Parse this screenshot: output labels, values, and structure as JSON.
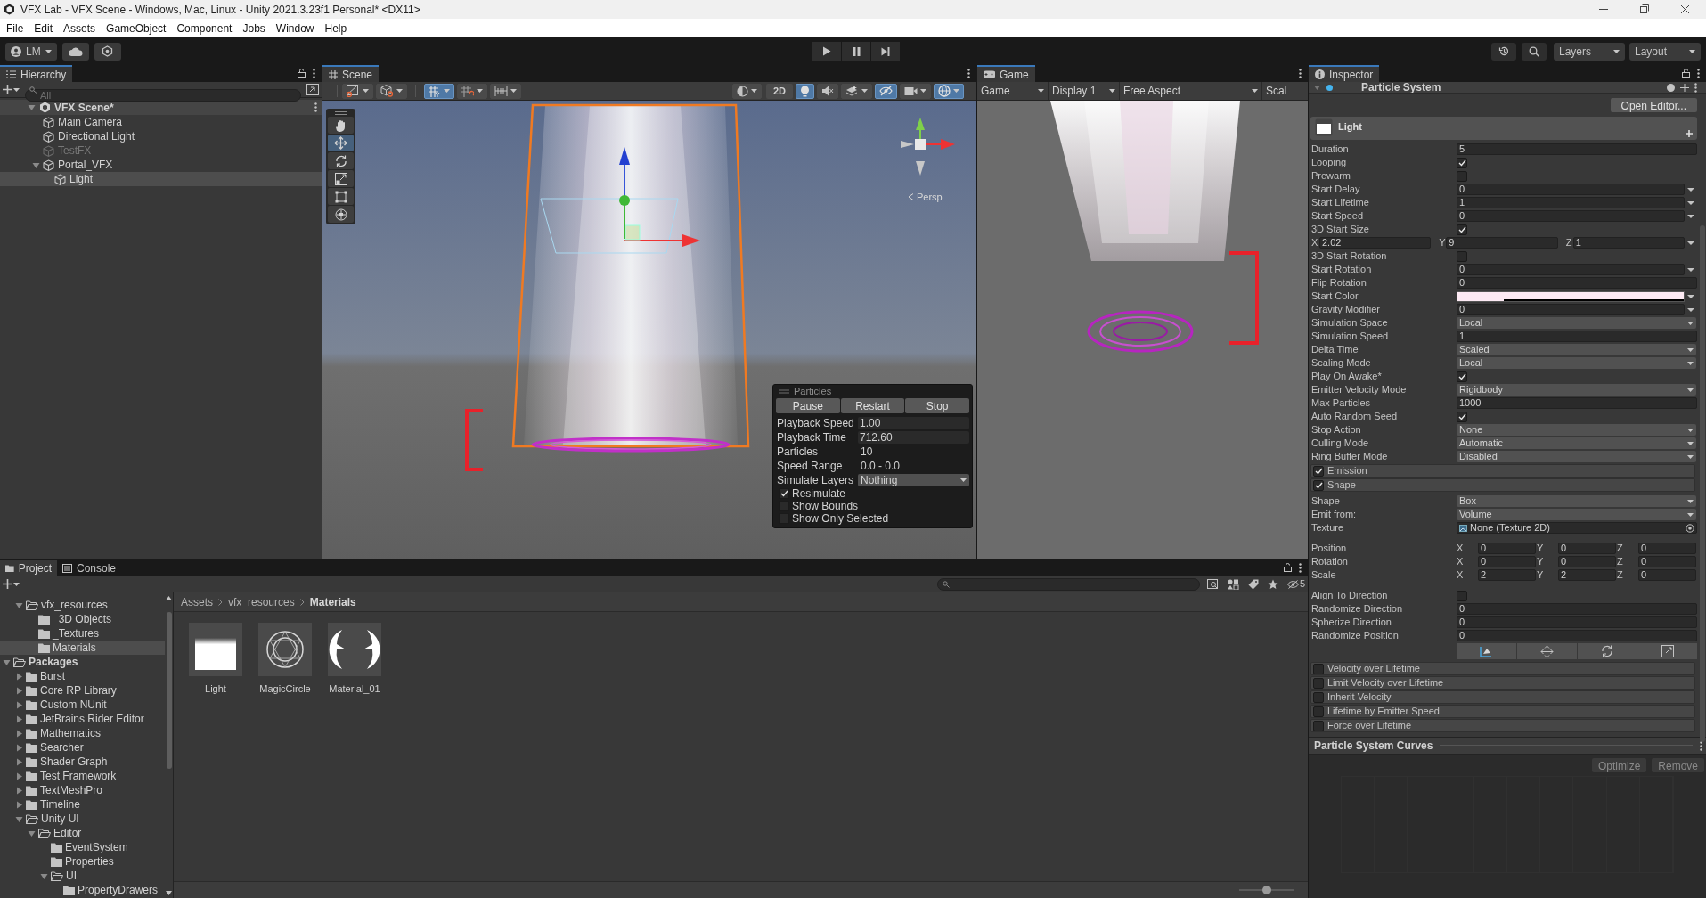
{
  "window": {
    "title": "VFX Lab - VFX Scene - Windows, Mac, Linux - Unity 2021.3.23f1 Personal* <DX11>"
  },
  "menu": [
    "File",
    "Edit",
    "Assets",
    "GameObject",
    "Component",
    "Jobs",
    "Window",
    "Help"
  ],
  "toolbar": {
    "account": "LM",
    "layers": "Layers",
    "layout": "Layout"
  },
  "hierarchy": {
    "title": "Hierarchy",
    "search_placeholder": "All",
    "scene": {
      "name": "VFX Scene*",
      "expanded": true
    },
    "objects": [
      {
        "name": "Main Camera",
        "active": true,
        "selected": false
      },
      {
        "name": "Directional Light",
        "active": true,
        "selected": false
      },
      {
        "name": "TestFX",
        "active": false,
        "selected": false
      },
      {
        "name": "Portal_VFX",
        "active": true,
        "selected": false,
        "expanded": true,
        "children": [
          {
            "name": "Light",
            "active": true,
            "selected": true
          }
        ]
      }
    ]
  },
  "scene_view": {
    "tab": "Scene",
    "toggle_2d": "2D",
    "persp": "Persp",
    "grid_on": true,
    "lighting_on": true,
    "hidden_on": true,
    "gizmos_on": true,
    "tools": [
      {
        "kind": "hand",
        "selected": false
      },
      {
        "kind": "move",
        "selected": true
      },
      {
        "kind": "rotate",
        "selected": false
      },
      {
        "kind": "scale",
        "selected": false
      },
      {
        "kind": "rect",
        "selected": false
      },
      {
        "kind": "transform",
        "selected": false
      }
    ]
  },
  "particles_overlay": {
    "title": "Particles",
    "buttons": [
      "Pause",
      "Restart",
      "Stop"
    ],
    "fields": [
      {
        "label": "Playback Speed",
        "value": "1.00",
        "kind": "input"
      },
      {
        "label": "Playback Time",
        "value": "712.60",
        "kind": "input"
      },
      {
        "label": "Particles",
        "value": "10",
        "kind": "text"
      },
      {
        "label": "Speed Range",
        "value": "0.0 - 0.0",
        "kind": "text"
      },
      {
        "label": "Simulate Layers",
        "value": "Nothing",
        "kind": "dropdown"
      }
    ],
    "options": [
      {
        "label": "Resimulate",
        "checked": true
      },
      {
        "label": "Show Bounds",
        "checked": false
      },
      {
        "label": "Show Only Selected",
        "checked": false
      }
    ]
  },
  "game_view": {
    "tab": "Game",
    "dropdowns": [
      "Game",
      "Display 1",
      "Free Aspect"
    ],
    "scale_label": "Scal"
  },
  "inspector": {
    "tab": "Inspector",
    "component": "Particle System",
    "open_editor": "Open Editor...",
    "system_name": "Light",
    "main": [
      {
        "label": "Duration",
        "kind": "input",
        "value": "5"
      },
      {
        "label": "Looping",
        "kind": "checkbox",
        "checked": true
      },
      {
        "label": "Prewarm",
        "kind": "checkbox",
        "checked": false
      },
      {
        "label": "Start Delay",
        "kind": "curve",
        "value": "0"
      },
      {
        "label": "Start Lifetime",
        "kind": "curve",
        "value": "1"
      },
      {
        "label": "Start Speed",
        "kind": "curve",
        "value": "0"
      },
      {
        "label": "3D Start Size",
        "kind": "checkbox",
        "checked": true
      },
      {
        "kind": "xyz",
        "axes": [
          {
            "axis": "X",
            "value": "2.02"
          },
          {
            "axis": "Y",
            "value": "9"
          },
          {
            "axis": "Z",
            "value": "1"
          }
        ]
      },
      {
        "label": "3D Start Rotation",
        "kind": "checkbox",
        "checked": false
      },
      {
        "label": "Start Rotation",
        "kind": "curve",
        "value": "0"
      },
      {
        "label": "Flip Rotation",
        "kind": "input",
        "value": "0"
      },
      {
        "label": "Start Color",
        "kind": "color",
        "color": "#fdeaf4"
      },
      {
        "label": "Gravity Modifier",
        "kind": "curve",
        "value": "0"
      },
      {
        "label": "Simulation Space",
        "kind": "dropdown",
        "value": "Local"
      },
      {
        "label": "Simulation Speed",
        "kind": "input",
        "value": "1"
      },
      {
        "label": "Delta Time",
        "kind": "dropdown",
        "value": "Scaled"
      },
      {
        "label": "Scaling Mode",
        "kind": "dropdown",
        "value": "Local"
      },
      {
        "label": "Play On Awake*",
        "kind": "checkbox",
        "checked": true
      },
      {
        "label": "Emitter Velocity Mode",
        "kind": "dropdown",
        "value": "Rigidbody"
      },
      {
        "label": "Max Particles",
        "kind": "input",
        "value": "1000"
      },
      {
        "label": "Auto Random Seed",
        "kind": "checkbox",
        "checked": true
      },
      {
        "label": "Stop Action",
        "kind": "dropdown",
        "value": "None"
      },
      {
        "label": "Culling Mode",
        "kind": "dropdown",
        "value": "Automatic"
      },
      {
        "label": "Ring Buffer Mode",
        "kind": "dropdown",
        "value": "Disabled"
      }
    ],
    "modules": [
      {
        "name": "Emission",
        "enabled": true
      },
      {
        "name": "Shape",
        "enabled": true,
        "props": [
          {
            "label": "Shape",
            "kind": "dropdown",
            "value": "Box"
          },
          {
            "label": "Emit from:",
            "kind": "dropdown",
            "value": "Volume"
          },
          {
            "label": "Texture",
            "kind": "object",
            "value": "None (Texture 2D)"
          },
          {
            "label": "Position",
            "kind": "vector3",
            "axes": [
              {
                "axis": "X",
                "value": "0"
              },
              {
                "axis": "Y",
                "value": "0"
              },
              {
                "axis": "Z",
                "value": "0"
              }
            ]
          },
          {
            "label": "Rotation",
            "kind": "vector3",
            "axes": [
              {
                "axis": "X",
                "value": "0"
              },
              {
                "axis": "Y",
                "value": "0"
              },
              {
                "axis": "Z",
                "value": "0"
              }
            ]
          },
          {
            "label": "Scale",
            "kind": "vector3",
            "axes": [
              {
                "axis": "X",
                "value": "2"
              },
              {
                "axis": "Y",
                "value": "2"
              },
              {
                "axis": "Z",
                "value": "0"
              }
            ]
          },
          {
            "label": "Align To Direction",
            "kind": "checkbox",
            "checked": false
          },
          {
            "label": "Randomize Direction",
            "kind": "input",
            "value": "0"
          },
          {
            "label": "Spherize Direction",
            "kind": "input",
            "value": "0"
          },
          {
            "label": "Randomize Position",
            "kind": "input",
            "value": "0"
          }
        ]
      },
      {
        "name": "Velocity over Lifetime",
        "enabled": false
      },
      {
        "name": "Limit Velocity over Lifetime",
        "enabled": false
      },
      {
        "name": "Inherit Velocity",
        "enabled": false
      },
      {
        "name": "Lifetime by Emitter Speed",
        "enabled": false
      },
      {
        "name": "Force over Lifetime",
        "enabled": false
      }
    ],
    "curves": {
      "title": "Particle System Curves",
      "buttons": [
        "Optimize",
        "Remove"
      ]
    }
  },
  "project": {
    "tabs": [
      {
        "label": "Project",
        "selected": true
      },
      {
        "label": "Console",
        "selected": false
      }
    ],
    "hidden_count": "5",
    "assets_tree": [
      {
        "name": "vfx_resources",
        "expanded": true,
        "selected": false,
        "children": [
          {
            "name": "_3D Objects",
            "selected": false
          },
          {
            "name": "_Textures",
            "selected": false
          },
          {
            "name": "Materials",
            "selected": true
          }
        ]
      }
    ],
    "packages": {
      "name": "Packages",
      "expanded": true,
      "children": [
        {
          "name": "Burst",
          "expanded": false
        },
        {
          "name": "Core RP Library",
          "expanded": false
        },
        {
          "name": "Custom NUnit",
          "expanded": false
        },
        {
          "name": "JetBrains Rider Editor",
          "expanded": false
        },
        {
          "name": "Mathematics",
          "expanded": false
        },
        {
          "name": "Searcher",
          "expanded": false
        },
        {
          "name": "Shader Graph",
          "expanded": false
        },
        {
          "name": "Test Framework",
          "expanded": false
        },
        {
          "name": "TextMeshPro",
          "expanded": false
        },
        {
          "name": "Timeline",
          "expanded": false
        },
        {
          "name": "Unity UI",
          "expanded": true,
          "children": [
            {
              "name": "Editor",
              "expanded": true,
              "children": [
                {
                  "name": "EventSystem"
                },
                {
                  "name": "Properties"
                },
                {
                  "name": "UI",
                  "expanded": true,
                  "children": [
                    {
                      "name": "PropertyDrawers"
                    }
                  ]
                }
              ]
            }
          ]
        }
      ]
    },
    "breadcrumb": [
      "Assets",
      "vfx_resources",
      "Materials"
    ],
    "assets": [
      {
        "name": "Light",
        "kind": "quad"
      },
      {
        "name": "MagicCircle",
        "kind": "circle"
      },
      {
        "name": "Material_01",
        "kind": "crescents"
      }
    ],
    "icon_size": {
      "level": 0.5
    }
  }
}
